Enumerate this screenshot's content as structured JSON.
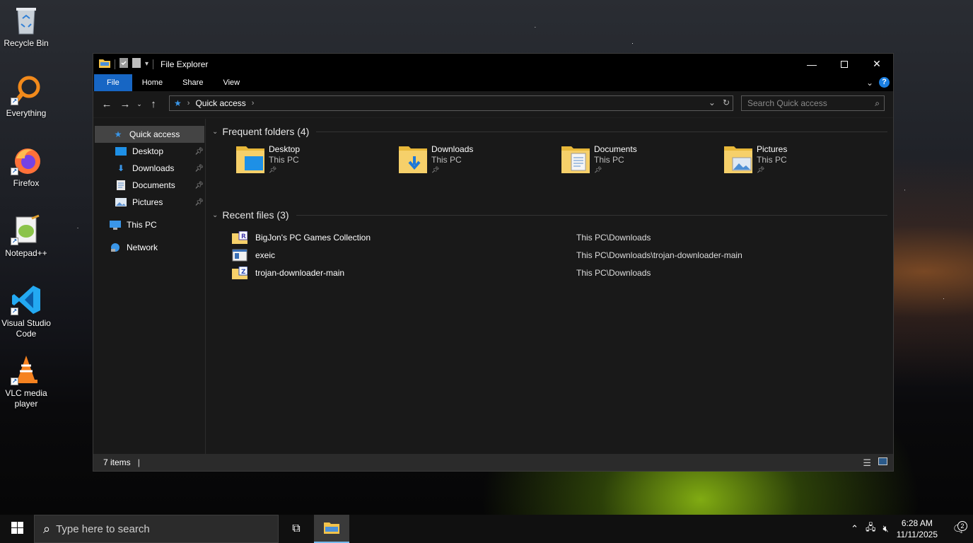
{
  "desktop": {
    "icons": [
      {
        "label": "Recycle Bin",
        "icon": "recycle-bin-icon"
      },
      {
        "label": "Everything",
        "icon": "everything-search-icon"
      },
      {
        "label": "Firefox",
        "icon": "firefox-icon"
      },
      {
        "label": "Notepad++",
        "icon": "notepad-plus-plus-icon"
      },
      {
        "label": "Visual Studio Code",
        "icon": "vscode-icon"
      },
      {
        "label": "VLC media player",
        "icon": "vlc-icon"
      }
    ]
  },
  "window": {
    "title": "File Explorer",
    "ribbon_tabs": [
      "File",
      "Home",
      "Share",
      "View"
    ],
    "address": {
      "crumb": "Quick access"
    },
    "search": {
      "placeholder": "Search Quick access"
    }
  },
  "sidebar": {
    "items": [
      {
        "label": "Quick access",
        "icon": "star-icon",
        "active": true,
        "pinned": false
      },
      {
        "label": "Desktop",
        "icon": "desktop-folder-icon",
        "pinned": true
      },
      {
        "label": "Downloads",
        "icon": "download-arrow-icon",
        "pinned": true
      },
      {
        "label": "Documents",
        "icon": "documents-icon",
        "pinned": true
      },
      {
        "label": "Pictures",
        "icon": "pictures-icon",
        "pinned": true
      },
      {
        "label": "This PC",
        "icon": "computer-icon",
        "pinned": false
      },
      {
        "label": "Network",
        "icon": "network-icon",
        "pinned": false
      }
    ]
  },
  "frequent": {
    "heading": "Frequent folders (4)",
    "folders": [
      {
        "name": "Desktop",
        "location": "This PC"
      },
      {
        "name": "Downloads",
        "location": "This PC"
      },
      {
        "name": "Documents",
        "location": "This PC"
      },
      {
        "name": "Pictures",
        "location": "This PC"
      }
    ]
  },
  "recent": {
    "heading": "Recent files (3)",
    "files": [
      {
        "name": "BigJon's PC Games Collection",
        "path": "This PC\\Downloads"
      },
      {
        "name": "exeic",
        "path": "This PC\\Downloads\\trojan-downloader-main"
      },
      {
        "name": "trojan-downloader-main",
        "path": "This PC\\Downloads"
      }
    ]
  },
  "status": {
    "items_count": "7 items",
    "cursor": "|"
  },
  "taskbar": {
    "search_placeholder": "Type here to search",
    "time": "6:28 AM",
    "date": "11/11/2025",
    "notification_count": "2"
  },
  "colors": {
    "accent": "#1766c4",
    "window_bg": "#191919",
    "folder_yellow": "#f3c34a"
  }
}
